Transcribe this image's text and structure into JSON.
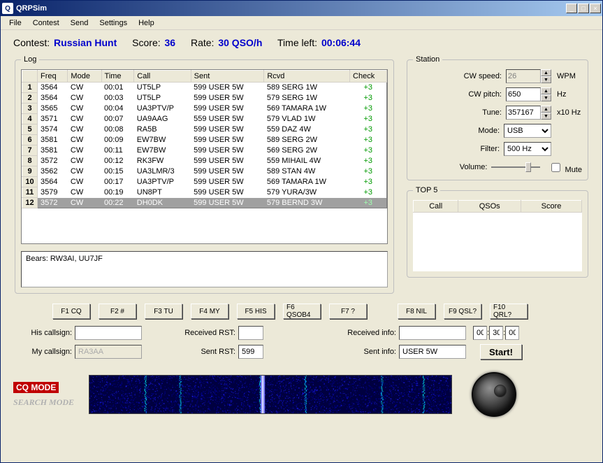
{
  "window": {
    "title": "QRPSim"
  },
  "menu": [
    "File",
    "Contest",
    "Send",
    "Settings",
    "Help"
  ],
  "header": {
    "contest_lbl": "Contest:",
    "contest": "Russian Hunt",
    "score_lbl": "Score:",
    "score": "36",
    "rate_lbl": "Rate:",
    "rate": "30 QSO/h",
    "timeleft_lbl": "Time left:",
    "timeleft": "00:06:44"
  },
  "log": {
    "legend": "Log",
    "cols": [
      "",
      "Freq",
      "Mode",
      "Time",
      "Call",
      "Sent",
      "Rcvd",
      "Check"
    ],
    "rows": [
      {
        "n": "1",
        "freq": "3564",
        "mode": "CW",
        "time": "00:01",
        "call": "UT5LP",
        "sent": "599 USER 5W",
        "rcvd": "589 SERG 1W",
        "check": "+3"
      },
      {
        "n": "2",
        "freq": "3564",
        "mode": "CW",
        "time": "00:03",
        "call": "UT5LP",
        "sent": "599 USER 5W",
        "rcvd": "579 SERG 1W",
        "check": "+3"
      },
      {
        "n": "3",
        "freq": "3565",
        "mode": "CW",
        "time": "00:04",
        "call": "UA3PTV/P",
        "sent": "599 USER 5W",
        "rcvd": "569 TAMARA 1W",
        "check": "+3"
      },
      {
        "n": "4",
        "freq": "3571",
        "mode": "CW",
        "time": "00:07",
        "call": "UA9AAG",
        "sent": "559 USER 5W",
        "rcvd": "579 VLAD 1W",
        "check": "+3"
      },
      {
        "n": "5",
        "freq": "3574",
        "mode": "CW",
        "time": "00:08",
        "call": "RA5B",
        "sent": "599 USER 5W",
        "rcvd": "559 DAZ 4W",
        "check": "+3"
      },
      {
        "n": "6",
        "freq": "3581",
        "mode": "CW",
        "time": "00:09",
        "call": "EW7BW",
        "sent": "599 USER 5W",
        "rcvd": "589 SERG 2W",
        "check": "+3"
      },
      {
        "n": "7",
        "freq": "3581",
        "mode": "CW",
        "time": "00:11",
        "call": "EW7BW",
        "sent": "599 USER 5W",
        "rcvd": "569 SERG 2W",
        "check": "+3"
      },
      {
        "n": "8",
        "freq": "3572",
        "mode": "CW",
        "time": "00:12",
        "call": "RK3FW",
        "sent": "599 USER 5W",
        "rcvd": "559 MIHAIL 4W",
        "check": "+3"
      },
      {
        "n": "9",
        "freq": "3562",
        "mode": "CW",
        "time": "00:15",
        "call": "UA3LMR/3",
        "sent": "599 USER 5W",
        "rcvd": "589 STAN 4W",
        "check": "+3"
      },
      {
        "n": "10",
        "freq": "3564",
        "mode": "CW",
        "time": "00:17",
        "call": "UA3PTV/P",
        "sent": "599 USER 5W",
        "rcvd": "569 TAMARA 1W",
        "check": "+3"
      },
      {
        "n": "11",
        "freq": "3579",
        "mode": "CW",
        "time": "00:19",
        "call": "UN8PT",
        "sent": "599 USER 5W",
        "rcvd": "579 YURA/3W",
        "check": "+3"
      },
      {
        "n": "12",
        "freq": "3572",
        "mode": "CW",
        "time": "00:22",
        "call": "DH0DK",
        "sent": "599 USER 5W",
        "rcvd": "579 BERND 3W",
        "check": "+3"
      }
    ],
    "selected": 11,
    "bears": "Bears: RW3AI, UU7JF"
  },
  "station": {
    "legend": "Station",
    "cwspeed_lbl": "CW speed:",
    "cwspeed": "26",
    "cwspeed_unit": "WPM",
    "cwpitch_lbl": "CW pitch:",
    "cwpitch": "650",
    "cwpitch_unit": "Hz",
    "tune_lbl": "Tune:",
    "tune": "357167",
    "tune_unit": "x10 Hz",
    "mode_lbl": "Mode:",
    "mode": "USB",
    "filter_lbl": "Filter:",
    "filter": "500 Hz",
    "volume_lbl": "Volume:",
    "mute_lbl": "Mute"
  },
  "top5": {
    "legend": "TOP 5",
    "cols": [
      "Call",
      "QSOs",
      "Score"
    ]
  },
  "fkeys": [
    "F1 CQ",
    "F2 #",
    "F3 TU",
    "F4 MY",
    "F5 HIS",
    "F6 QSOB4",
    "F7 ?",
    "F8 NIL",
    "F9 QSL?",
    "F10 QRL?"
  ],
  "entry": {
    "hiscall_lbl": "His callsign:",
    "hiscall": "",
    "rrst_lbl": "Received RST:",
    "rrst": "",
    "rinfo_lbl": "Received info:",
    "rinfo": "",
    "t1": "00",
    "t2": "30",
    "t3": "00",
    "mycall_lbl": "My callsign:",
    "mycall": "RA3AA",
    "srst_lbl": "Sent RST:",
    "srst": "599",
    "sinfo_lbl": "Sent info:",
    "sinfo": "USER 5W",
    "start": "Start!"
  },
  "modes": {
    "cq": "CQ MODE",
    "search": "SEARCH MODE"
  }
}
